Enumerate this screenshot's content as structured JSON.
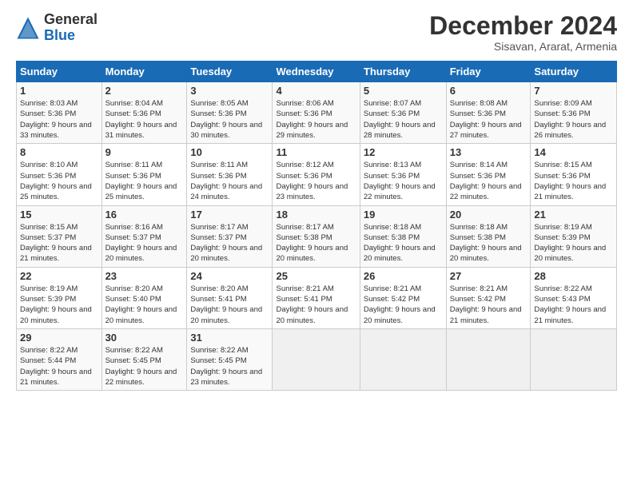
{
  "logo": {
    "general": "General",
    "blue": "Blue"
  },
  "header": {
    "month": "December 2024",
    "location": "Sisavan, Ararat, Armenia"
  },
  "weekdays": [
    "Sunday",
    "Monday",
    "Tuesday",
    "Wednesday",
    "Thursday",
    "Friday",
    "Saturday"
  ],
  "weeks": [
    [
      {
        "day": "1",
        "sunrise": "8:03 AM",
        "sunset": "5:36 PM",
        "daylight": "9 hours and 33 minutes."
      },
      {
        "day": "2",
        "sunrise": "8:04 AM",
        "sunset": "5:36 PM",
        "daylight": "9 hours and 31 minutes."
      },
      {
        "day": "3",
        "sunrise": "8:05 AM",
        "sunset": "5:36 PM",
        "daylight": "9 hours and 30 minutes."
      },
      {
        "day": "4",
        "sunrise": "8:06 AM",
        "sunset": "5:36 PM",
        "daylight": "9 hours and 29 minutes."
      },
      {
        "day": "5",
        "sunrise": "8:07 AM",
        "sunset": "5:36 PM",
        "daylight": "9 hours and 28 minutes."
      },
      {
        "day": "6",
        "sunrise": "8:08 AM",
        "sunset": "5:36 PM",
        "daylight": "9 hours and 27 minutes."
      },
      {
        "day": "7",
        "sunrise": "8:09 AM",
        "sunset": "5:36 PM",
        "daylight": "9 hours and 26 minutes."
      }
    ],
    [
      {
        "day": "8",
        "sunrise": "8:10 AM",
        "sunset": "5:36 PM",
        "daylight": "9 hours and 25 minutes."
      },
      {
        "day": "9",
        "sunrise": "8:11 AM",
        "sunset": "5:36 PM",
        "daylight": "9 hours and 25 minutes."
      },
      {
        "day": "10",
        "sunrise": "8:11 AM",
        "sunset": "5:36 PM",
        "daylight": "9 hours and 24 minutes."
      },
      {
        "day": "11",
        "sunrise": "8:12 AM",
        "sunset": "5:36 PM",
        "daylight": "9 hours and 23 minutes."
      },
      {
        "day": "12",
        "sunrise": "8:13 AM",
        "sunset": "5:36 PM",
        "daylight": "9 hours and 22 minutes."
      },
      {
        "day": "13",
        "sunrise": "8:14 AM",
        "sunset": "5:36 PM",
        "daylight": "9 hours and 22 minutes."
      },
      {
        "day": "14",
        "sunrise": "8:15 AM",
        "sunset": "5:36 PM",
        "daylight": "9 hours and 21 minutes."
      }
    ],
    [
      {
        "day": "15",
        "sunrise": "8:15 AM",
        "sunset": "5:37 PM",
        "daylight": "9 hours and 21 minutes."
      },
      {
        "day": "16",
        "sunrise": "8:16 AM",
        "sunset": "5:37 PM",
        "daylight": "9 hours and 20 minutes."
      },
      {
        "day": "17",
        "sunrise": "8:17 AM",
        "sunset": "5:37 PM",
        "daylight": "9 hours and 20 minutes."
      },
      {
        "day": "18",
        "sunrise": "8:17 AM",
        "sunset": "5:38 PM",
        "daylight": "9 hours and 20 minutes."
      },
      {
        "day": "19",
        "sunrise": "8:18 AM",
        "sunset": "5:38 PM",
        "daylight": "9 hours and 20 minutes."
      },
      {
        "day": "20",
        "sunrise": "8:18 AM",
        "sunset": "5:38 PM",
        "daylight": "9 hours and 20 minutes."
      },
      {
        "day": "21",
        "sunrise": "8:19 AM",
        "sunset": "5:39 PM",
        "daylight": "9 hours and 20 minutes."
      }
    ],
    [
      {
        "day": "22",
        "sunrise": "8:19 AM",
        "sunset": "5:39 PM",
        "daylight": "9 hours and 20 minutes."
      },
      {
        "day": "23",
        "sunrise": "8:20 AM",
        "sunset": "5:40 PM",
        "daylight": "9 hours and 20 minutes."
      },
      {
        "day": "24",
        "sunrise": "8:20 AM",
        "sunset": "5:41 PM",
        "daylight": "9 hours and 20 minutes."
      },
      {
        "day": "25",
        "sunrise": "8:21 AM",
        "sunset": "5:41 PM",
        "daylight": "9 hours and 20 minutes."
      },
      {
        "day": "26",
        "sunrise": "8:21 AM",
        "sunset": "5:42 PM",
        "daylight": "9 hours and 20 minutes."
      },
      {
        "day": "27",
        "sunrise": "8:21 AM",
        "sunset": "5:42 PM",
        "daylight": "9 hours and 21 minutes."
      },
      {
        "day": "28",
        "sunrise": "8:22 AM",
        "sunset": "5:43 PM",
        "daylight": "9 hours and 21 minutes."
      }
    ],
    [
      {
        "day": "29",
        "sunrise": "8:22 AM",
        "sunset": "5:44 PM",
        "daylight": "9 hours and 21 minutes."
      },
      {
        "day": "30",
        "sunrise": "8:22 AM",
        "sunset": "5:45 PM",
        "daylight": "9 hours and 22 minutes."
      },
      {
        "day": "31",
        "sunrise": "8:22 AM",
        "sunset": "5:45 PM",
        "daylight": "9 hours and 23 minutes."
      },
      null,
      null,
      null,
      null
    ]
  ]
}
